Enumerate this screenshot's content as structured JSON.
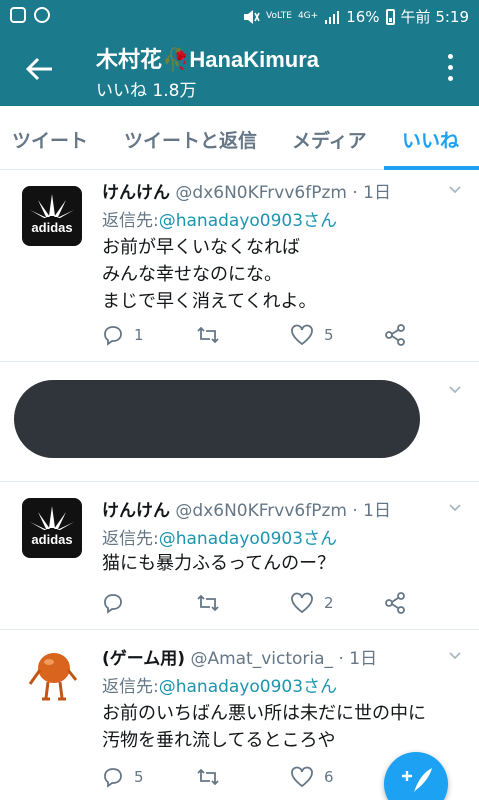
{
  "status_bar": {
    "network": "4G+",
    "volte": "VoLTE",
    "battery": "16%",
    "time": "午前 5:19"
  },
  "app_bar": {
    "title": "木村花🥀HanaKimura",
    "subtitle": "いいね 1.8万"
  },
  "tabs": [
    {
      "label": "ツイート"
    },
    {
      "label": "ツイートと返信"
    },
    {
      "label": "メディア"
    },
    {
      "label": "いいね",
      "active": true
    }
  ],
  "tweets": [
    {
      "name": "けんけん",
      "handle": "@dx6N0KFrvv6fPzm",
      "time": "1日",
      "reply_prefix": "返信先:",
      "reply_to": "@hanadayo0903さん",
      "lines": [
        "お前が早くいなくなれば",
        "みんな幸せなのにな。",
        "まじで早く消えてくれよ。"
      ],
      "replies": "1",
      "retweets": "",
      "likes": "5",
      "avatar": "adidas",
      "avatar_text": "adidas"
    },
    {
      "name": "",
      "handle": "",
      "time": "",
      "lines": [],
      "replies": "",
      "retweets": "",
      "likes": "",
      "redacted": true
    },
    {
      "name": "けんけん",
      "handle": "@dx6N0KFrvv6fPzm",
      "time": "1日",
      "reply_prefix": "返信先:",
      "reply_to": "@hanadayo0903さん",
      "lines": [
        "猫にも暴力ふるってんのー？"
      ],
      "replies": "",
      "retweets": "",
      "likes": "2",
      "avatar": "adidas",
      "avatar_text": "adidas"
    },
    {
      "name": "(ゲーム用)",
      "handle": "@Amat_victoria_",
      "time": "1日",
      "reply_prefix": "返信先:",
      "reply_to": "@hanadayo0903さん",
      "lines": [
        "お前のいちばん悪い所は未だに世の中に",
        "汚物を垂れ流してるところや"
      ],
      "replies": "5",
      "retweets": "",
      "likes": "6",
      "avatar": "orange-figure"
    }
  ],
  "fab": {
    "icon": "compose-tweet-icon"
  },
  "colors": {
    "app_bar": "#1b7a8c",
    "accent": "#1da1f2",
    "secondary_text": "#657786",
    "mention": "#1b95b0"
  }
}
